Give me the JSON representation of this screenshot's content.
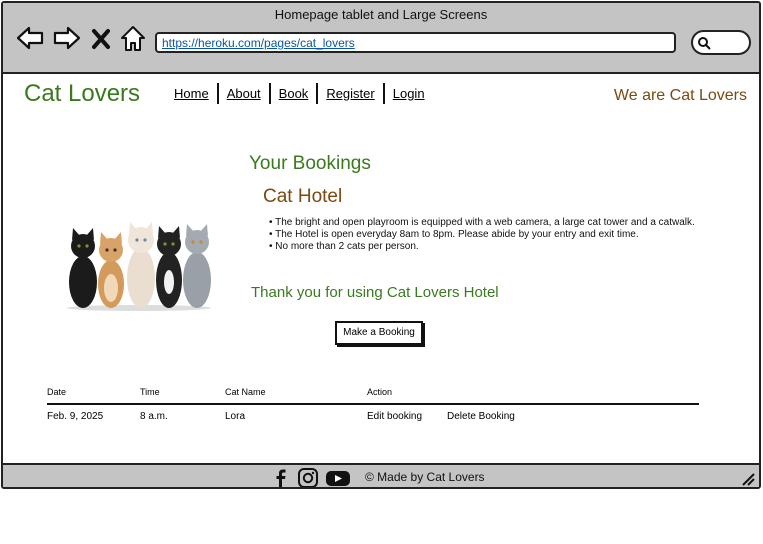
{
  "window": {
    "title": "Homepage tablet and Large Screens"
  },
  "browser": {
    "url": "https://heroku.com/pages/cat_lovers",
    "icons": [
      "arrow-left-icon",
      "arrow-right-icon",
      "close-icon",
      "home-icon",
      "search-icon"
    ]
  },
  "site": {
    "brand": "Cat Lovers",
    "tagline": "We are Cat Lovers",
    "nav": [
      "Home",
      "About",
      "Book",
      "Register",
      "Login"
    ]
  },
  "main": {
    "bookings_title": "Your Bookings",
    "hotel_title": "Cat Hotel",
    "rules": [
      "The bright and open playroom is equipped with a web camera, a large cat tower and a catwalk.",
      "The Hotel is open everyday 8am to 8pm. Please abide by your entry and exit time.",
      "No more than 2 cats per person."
    ],
    "thanks": "Thank you for using Cat Lovers Hotel",
    "booking_button": "Make a Booking"
  },
  "table": {
    "headers": [
      "Date",
      "Time",
      "Cat Name",
      "Action"
    ],
    "rows": [
      {
        "date": "Feb. 9, 2025",
        "time": "8 a.m.",
        "cat_name": "Lora",
        "edit": "Edit booking",
        "delete": "Delete Booking"
      }
    ]
  },
  "footer": {
    "copyright": "© Made by Cat Lovers",
    "social_icons": [
      "facebook-icon",
      "instagram-icon",
      "youtube-icon"
    ]
  },
  "colors": {
    "green": "#3a7a1e",
    "brown": "#7a4a10",
    "chrome": "#c4c4c4"
  }
}
